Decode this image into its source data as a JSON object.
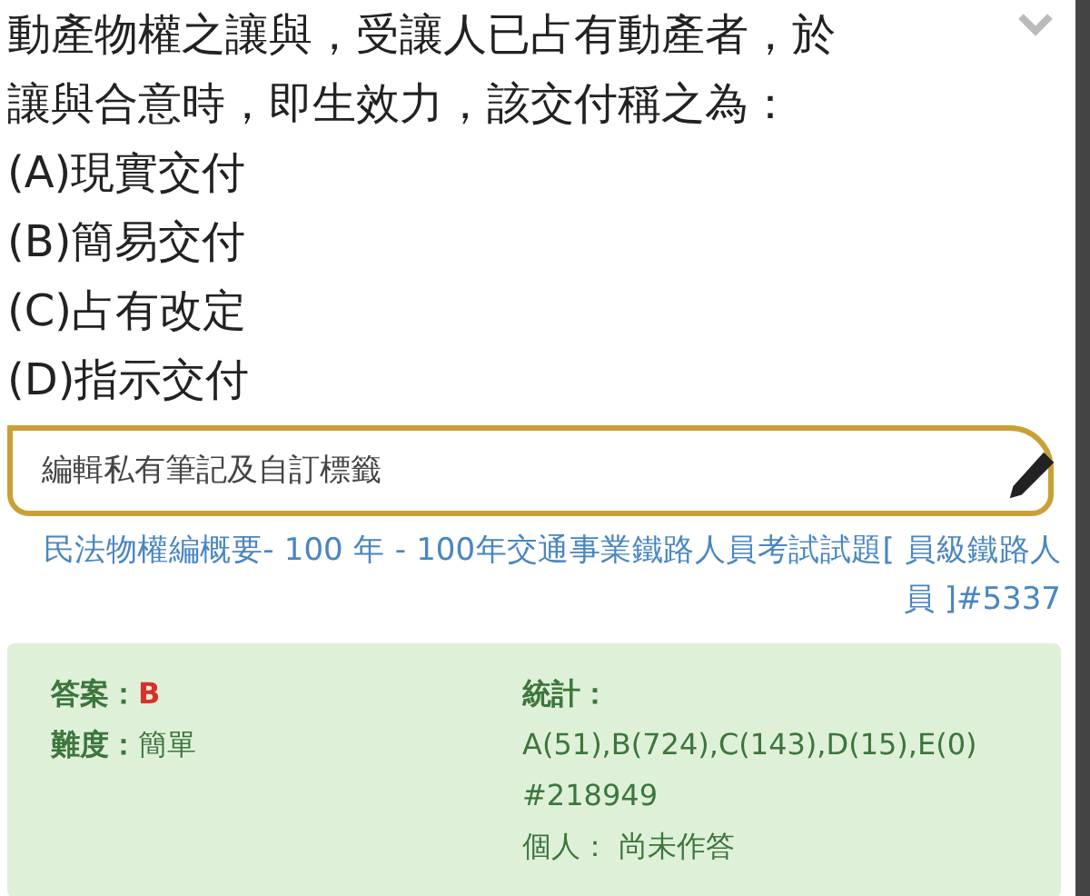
{
  "question": {
    "text": "動產物權之讓與，受讓人已占有動產者，於讓與合意時，即生效力，該交付稱之為：",
    "options": [
      "(A)現實交付",
      "(B)簡易交付",
      "(C)占有改定",
      "(D)指示交付"
    ]
  },
  "note_field": {
    "placeholder": "編輯私有筆記及自訂標籤"
  },
  "source_link": "民法物權編概要- 100 年 - 100年交通事業鐵路人員考試試題[ 員級鐵路人員 ]#5337",
  "info": {
    "answer_label": "答案：",
    "answer": "B",
    "difficulty_label": "難度：",
    "difficulty": "簡單",
    "stats_label": "統計：",
    "stats": "A(51),B(724),C(143),D(15),E(0)",
    "stats_id": "#218949",
    "personal": "個人： 尚未作答"
  }
}
